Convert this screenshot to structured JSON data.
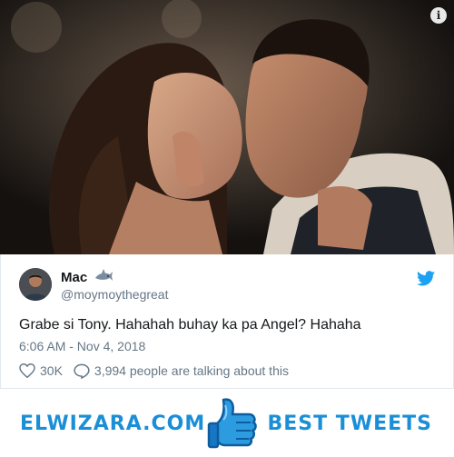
{
  "photo": {
    "subject": "kissing-couple-photo",
    "info_icon": "info-icon"
  },
  "tweet": {
    "user_name": "Mac",
    "user_handle": "@moymoythegreat",
    "name_emoji": "shark-icon",
    "text": "Grabe si Tony. Hahahah buhay ka pa Angel? Hahaha",
    "timestamp": "6:06 AM - Nov 4, 2018",
    "likes": "30K",
    "conversation": "3,994 people are talking about this",
    "brand_icon": "twitter-bird-icon",
    "colors": {
      "brand": "#1da1f2",
      "muted": "#657786",
      "text": "#14171a"
    }
  },
  "banner": {
    "left_text": "ELWIZARA.COM",
    "right_text": "BEST TWEETS",
    "center_icon": "thumbs-up-icon",
    "color": "#1a8fd8"
  }
}
